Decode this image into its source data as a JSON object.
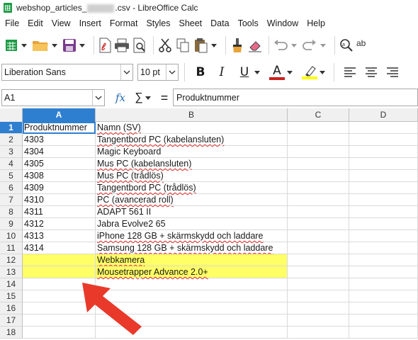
{
  "window": {
    "title_prefix": "webshop_articles_",
    "title_suffix": ".csv - LibreOffice Calc"
  },
  "menu": [
    "File",
    "Edit",
    "View",
    "Insert",
    "Format",
    "Styles",
    "Sheet",
    "Data",
    "Tools",
    "Window",
    "Help"
  ],
  "formatting": {
    "font_name": "Liberation Sans",
    "font_size": "10 pt",
    "bold_label": "B",
    "italic_label": "I",
    "underline_label": "U",
    "font_color_label": "A",
    "font_color": "#c9211e",
    "highlight_color": "#ffff00"
  },
  "formula_bar": {
    "name_box": "A1",
    "fx_label": "fx",
    "sigma_label": "∑",
    "equals_label": "=",
    "content": "Produktnummer"
  },
  "sheet": {
    "columns": [
      "A",
      "B",
      "C",
      "D"
    ],
    "active_column": "A",
    "active_row": "1",
    "rows": [
      {
        "num": "1",
        "a": "Produktnummer",
        "b": "Namn (SV)",
        "highlight": false
      },
      {
        "num": "2",
        "a": "4303",
        "b": "Tangentbord PC (kabelansluten)",
        "highlight": false
      },
      {
        "num": "3",
        "a": "4304",
        "b": "Magic Keyboard",
        "highlight": false
      },
      {
        "num": "4",
        "a": "4305",
        "b": "Mus PC (kabelansluten)",
        "highlight": false
      },
      {
        "num": "5",
        "a": "4308",
        "b": "Mus PC (trådlös)",
        "highlight": false
      },
      {
        "num": "6",
        "a": "4309",
        "b": "Tangentbord PC (trådlös)",
        "highlight": false
      },
      {
        "num": "7",
        "a": "4310",
        "b": "PC (avancerad roll)",
        "highlight": false
      },
      {
        "num": "8",
        "a": "4311",
        "b": "ADAPT 561 II",
        "highlight": false
      },
      {
        "num": "9",
        "a": "4312",
        "b": "Jabra Evolve2 65",
        "highlight": false
      },
      {
        "num": "10",
        "a": "4313",
        "b": "iPhone 128 GB + skärmskydd och laddare",
        "highlight": false
      },
      {
        "num": "11",
        "a": "4314",
        "b": "Samsung 128 GB + skärmskydd och laddare",
        "highlight": false
      },
      {
        "num": "12",
        "a": "",
        "b": "Webkamera",
        "highlight": true
      },
      {
        "num": "13",
        "a": "",
        "b": "Mousetrapper Advance 2.0+",
        "highlight": true
      },
      {
        "num": "14",
        "a": "",
        "b": "",
        "highlight": false
      },
      {
        "num": "15",
        "a": "",
        "b": "",
        "highlight": false
      },
      {
        "num": "16",
        "a": "",
        "b": "",
        "highlight": false
      },
      {
        "num": "17",
        "a": "",
        "b": "",
        "highlight": false
      },
      {
        "num": "18",
        "a": "",
        "b": "",
        "highlight": false
      }
    ]
  },
  "colors": {
    "highlight_fill": "#ffff66",
    "selection": "#2f7fd0",
    "annotation_arrow": "#e8392b"
  }
}
